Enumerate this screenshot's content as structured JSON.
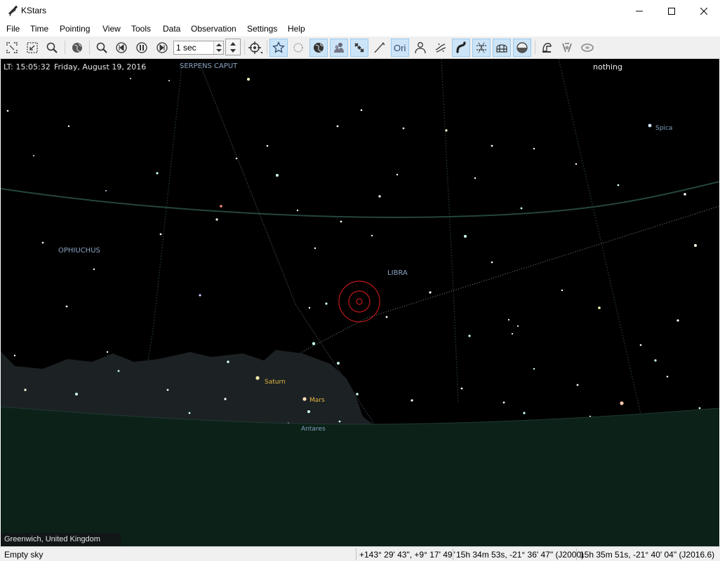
{
  "window": {
    "title": "KStars",
    "icon": "kstars-telescope-icon"
  },
  "menu": [
    "File",
    "Time",
    "Pointing",
    "View",
    "Tools",
    "Data",
    "Observation",
    "Settings",
    "Help"
  ],
  "toolbar": {
    "time_step": "1 sec",
    "icons": [
      "zoom-to-fit-icon",
      "zoom-to-region-icon",
      "find-object-icon",
      "set-location-icon",
      "zoom-icon",
      "step-backward-icon",
      "pause-icon",
      "step-forward-icon",
      "target-icon",
      "stars-toggle-icon",
      "deep-sky-toggle-icon",
      "solar-system-toggle-icon",
      "constellation-lines-icon",
      "satellites-icon",
      "supernovae-icon",
      "constellation-names-icon",
      "constellation-art-icon",
      "milky-way-icon",
      "equatorial-grid-icon",
      "horizontal-grid-icon",
      "ground-icon",
      "observing-list-icon",
      "fov-icon",
      "ekos-icon"
    ]
  },
  "skymap": {
    "lt_time": "LT: 15:05:32",
    "lt_date": "Friday, August 19, 2016",
    "focus_object": "nothing",
    "constellations": [
      "SERPENS CAPUT",
      "OPHIUCHUS",
      "LIBRA"
    ],
    "stars": [
      "Spica",
      "Antares"
    ],
    "planets": [
      "Saturn",
      "Mars"
    ],
    "location": "Greenwich, United Kingdom",
    "colors": {
      "sky": "#000000",
      "ground": "#0c2118",
      "horizon_line": "#1f3a33",
      "target_circle": "#c01818",
      "planet_label": "#e0b840"
    }
  },
  "statusbar": {
    "object_name": "Empty sky",
    "alt_az": "+143° 29' 43\", +9° 17' 49\"",
    "ra_dec_j2000": "15h 34m 53s, -21° 36' 47\" (J2000)",
    "ra_dec_jnow": "15h 35m 51s, -21° 40' 04\" (J2016.6)"
  }
}
